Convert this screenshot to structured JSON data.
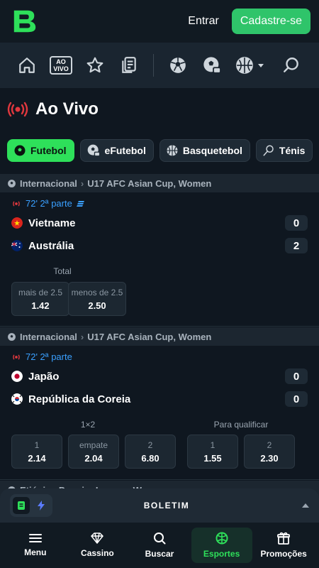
{
  "header": {
    "login_label": "Entrar",
    "signup_label": "Cadastre-se"
  },
  "nav": {
    "icons": [
      "home-icon",
      "live-icon",
      "star-icon",
      "betslip-icon",
      "soccer-icon",
      "virtual-soccer-icon",
      "basketball-icon",
      "search-icon"
    ],
    "live_line1": "AO",
    "live_line2": "VIVO"
  },
  "page": {
    "title": "Ao Vivo"
  },
  "tabs": [
    {
      "label": "Futebol",
      "icon": "soccer-icon",
      "active": true
    },
    {
      "label": "eFutebol",
      "icon": "virtual-soccer-icon",
      "active": false
    },
    {
      "label": "Basquetebol",
      "icon": "basketball-icon",
      "active": false
    },
    {
      "label": "Ténis",
      "icon": "tennis-icon",
      "active": false
    }
  ],
  "events": [
    {
      "category": "Internacional",
      "league": "U17 AFC Asian Cup, Women",
      "status": "72' 2ª parte",
      "home": {
        "name": "Vietname",
        "score": "0"
      },
      "away": {
        "name": "Austrália",
        "score": "2"
      },
      "market": "Total",
      "odds": [
        {
          "label": "mais de 2.5",
          "value": "1.42"
        },
        {
          "label": "menos de 2.5",
          "value": "2.50"
        }
      ]
    },
    {
      "category": "Internacional",
      "league": "U17 AFC Asian Cup, Women",
      "status": "72' 2ª parte",
      "home": {
        "name": "Japão",
        "score": "0"
      },
      "away": {
        "name": "República da Coreia",
        "score": "0"
      },
      "market": "1×2",
      "market2": "Para qualificar",
      "odds": [
        {
          "label": "1",
          "value": "2.14"
        },
        {
          "label": "empate",
          "value": "2.04"
        },
        {
          "label": "2",
          "value": "6.80"
        }
      ],
      "odds2": [
        {
          "label": "1",
          "value": "1.55"
        },
        {
          "label": "2",
          "value": "2.30"
        }
      ]
    }
  ],
  "next_league_partial": "Etiópia  ›  Premier League, Women",
  "betslip": {
    "label": "BOLETIM"
  },
  "bottom_nav": [
    {
      "label": "Menu",
      "icon": "menu-icon"
    },
    {
      "label": "Cassino",
      "icon": "diamond-icon"
    },
    {
      "label": "Buscar",
      "icon": "search-icon"
    },
    {
      "label": "Esportes",
      "icon": "sports-icon",
      "active": true
    },
    {
      "label": "Promoções",
      "icon": "gift-icon"
    }
  ],
  "colors": {
    "accent": "#2ee05a",
    "live_red": "#e0383e",
    "status_blue": "#3aa0ff",
    "background": "#0f1720"
  }
}
